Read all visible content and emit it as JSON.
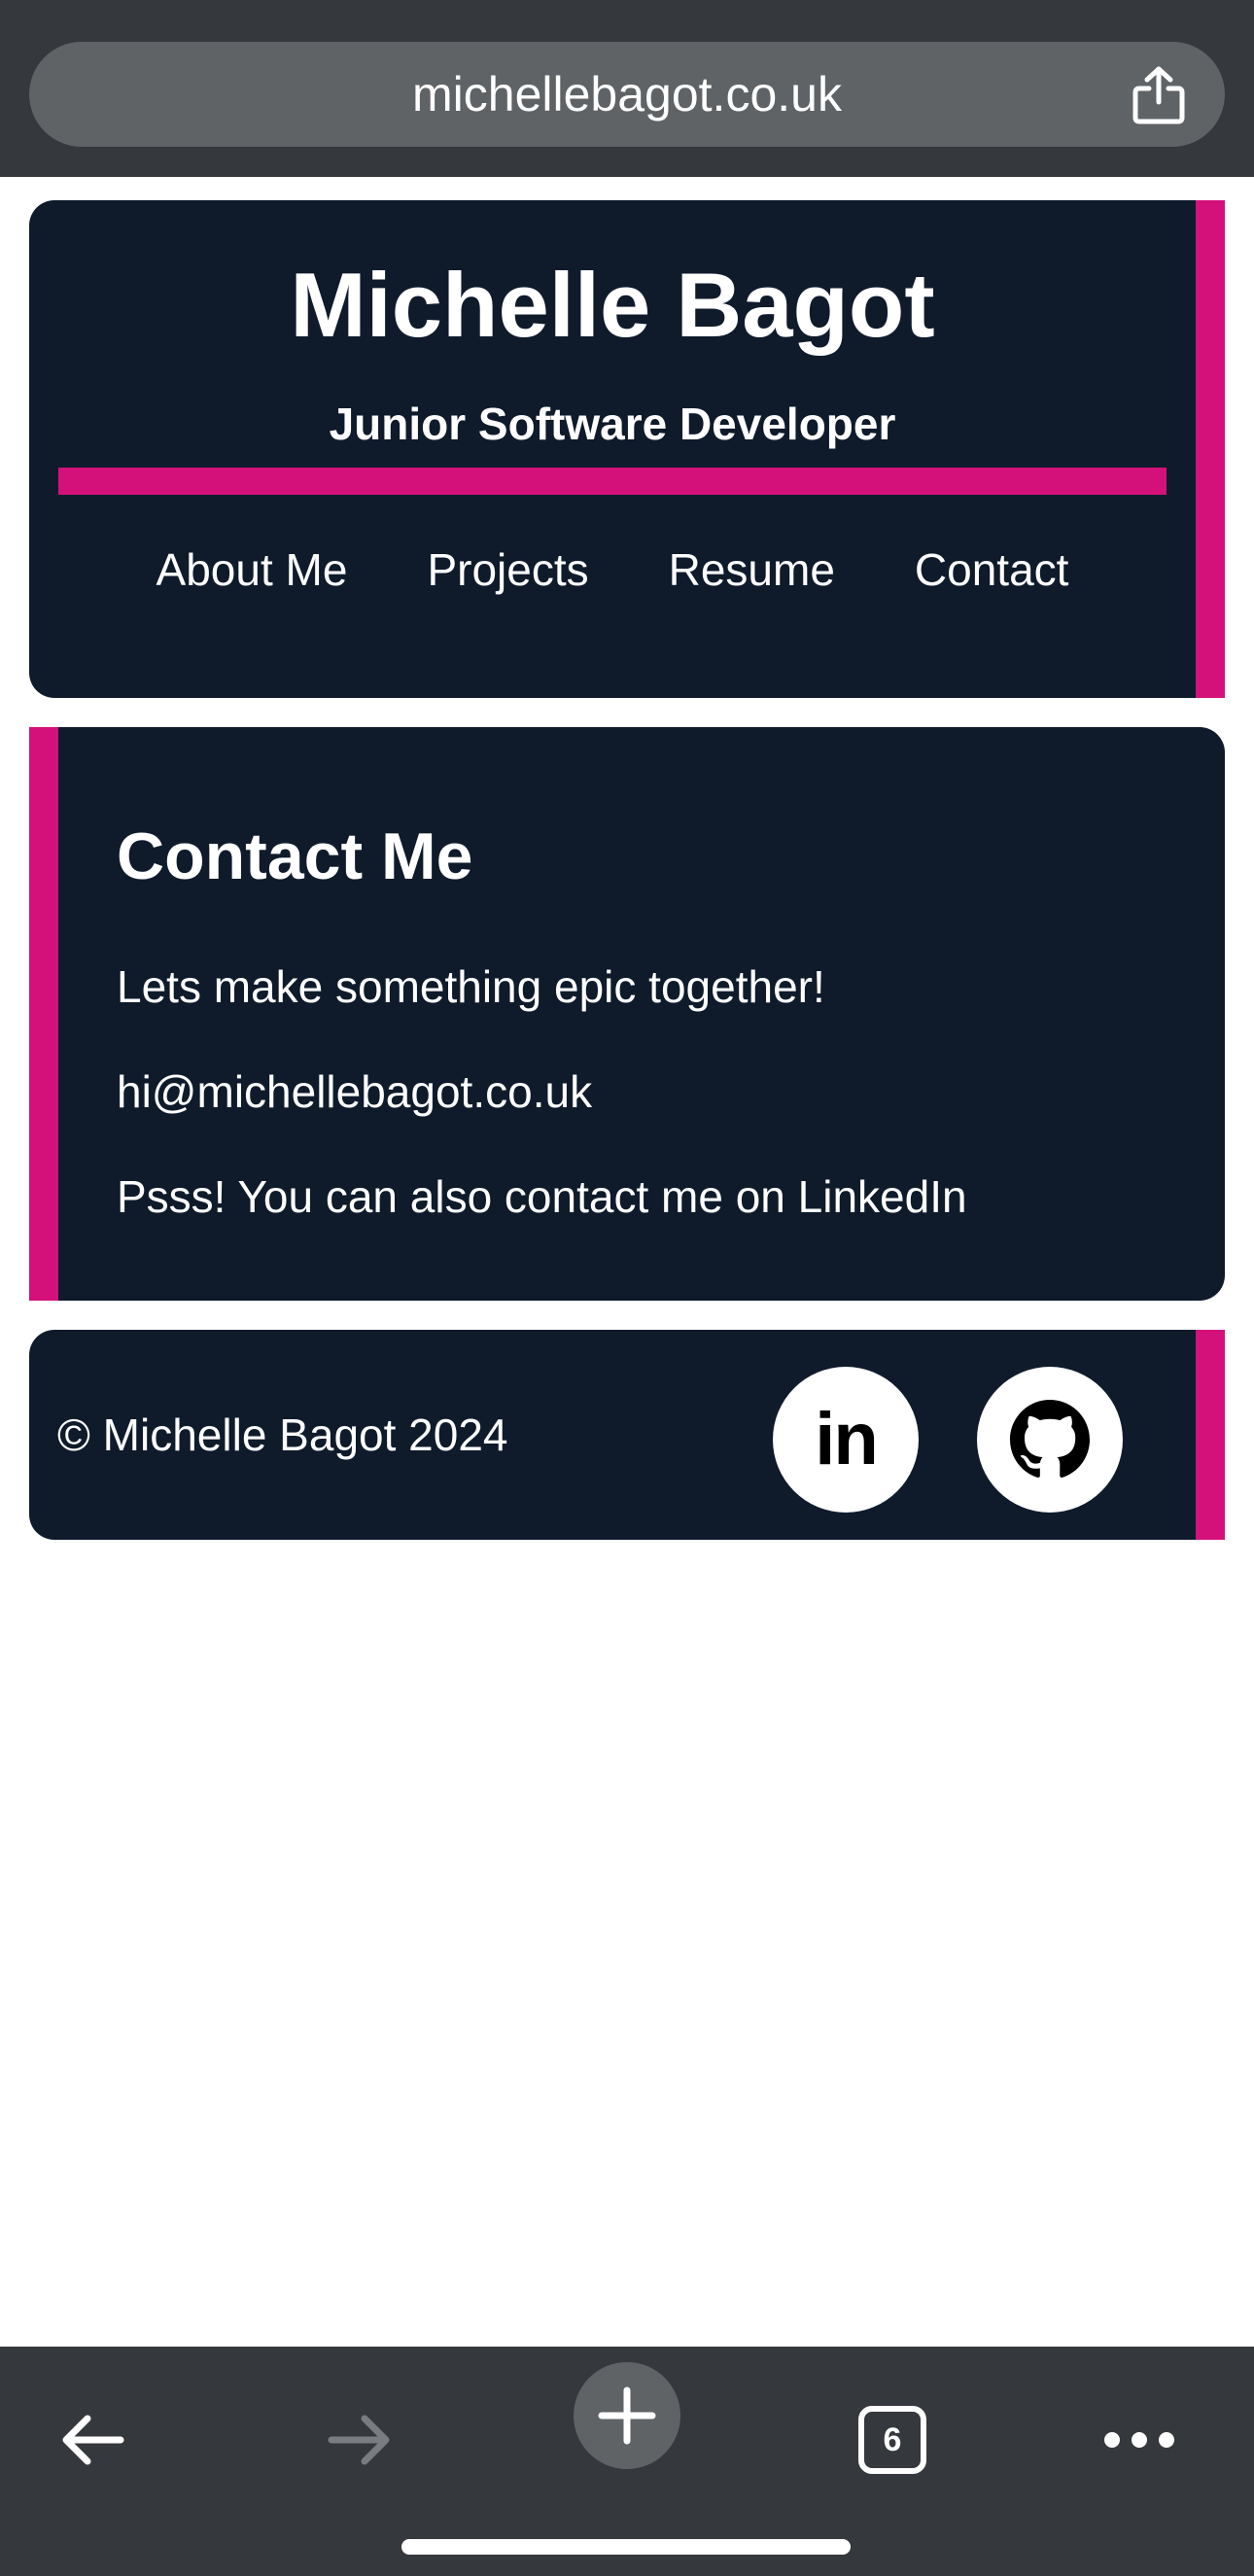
{
  "browser": {
    "url": "michellebagot.co.uk",
    "tab_count": "6"
  },
  "header": {
    "title": "Michelle Bagot",
    "subtitle": "Junior Software Developer",
    "nav": [
      {
        "label": "About Me"
      },
      {
        "label": "Projects"
      },
      {
        "label": "Resume"
      },
      {
        "label": "Contact"
      }
    ]
  },
  "contact": {
    "heading": "Contact Me",
    "lines": [
      "Lets make something epic together!",
      "hi@michellebagot.co.uk",
      "Psss! You can also contact me on LinkedIn"
    ]
  },
  "footer": {
    "copyright": "© Michelle Bagot 2024",
    "linkedin_text": "in"
  },
  "colors": {
    "card_bg": "#0f1b2b",
    "accent": "#d4117a",
    "browser_chrome": "#35383c"
  },
  "icons": {
    "share": "share-icon",
    "linkedin": "linkedin-icon",
    "github": "github-icon",
    "back": "back-arrow-icon",
    "forward": "forward-arrow-icon",
    "new_tab": "plus-icon",
    "more": "more-dots-icon"
  }
}
